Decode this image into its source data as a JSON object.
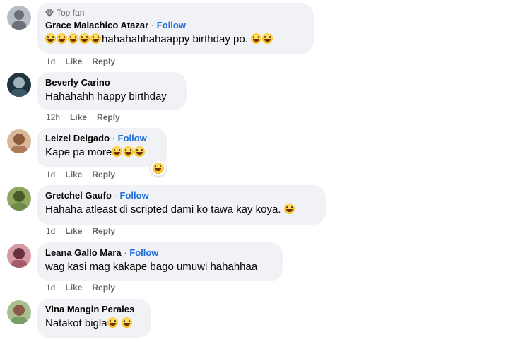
{
  "comments": [
    {
      "badge": "Top fan",
      "name": "Grace Malachico Atazar",
      "separator": "·",
      "follow": "Follow",
      "text": "hahahahhahaappy birthday po.",
      "time": "1d",
      "like": "Like",
      "reply": "Reply",
      "avatar_color": "#8a8f9a"
    },
    {
      "name": "Beverly Carino",
      "text": "Hahahahh happy birthday",
      "time": "12h",
      "like": "Like",
      "reply": "Reply",
      "avatar_color": "#2f4f5a"
    },
    {
      "name": "Leizel Delgado",
      "separator": "·",
      "follow": "Follow",
      "text": "Kape pa more",
      "time": "1d",
      "like": "Like",
      "reply": "Reply",
      "avatar_color": "#b07a5a"
    },
    {
      "name": "Gretchel Gaufo",
      "separator": "·",
      "follow": "Follow",
      "text": "Hahaha atleast di scripted dami ko tawa kay koya.",
      "time": "1d",
      "like": "Like",
      "reply": "Reply",
      "avatar_color": "#6f8a4a"
    },
    {
      "name": "Leana Gallo Mara",
      "separator": "·",
      "follow": "Follow",
      "text": "wag kasi mag kakape bago umuwi hahahhaa",
      "time": "1d",
      "like": "Like",
      "reply": "Reply",
      "avatar_color": "#a55a6a"
    },
    {
      "name": "Vina Mangin Perales",
      "text": "Natakot bigla",
      "avatar_color": "#7a9a6a"
    }
  ],
  "colors": {
    "bubble": "#f0f2f5",
    "follow": "#216fdb",
    "meta": "#65676b"
  }
}
